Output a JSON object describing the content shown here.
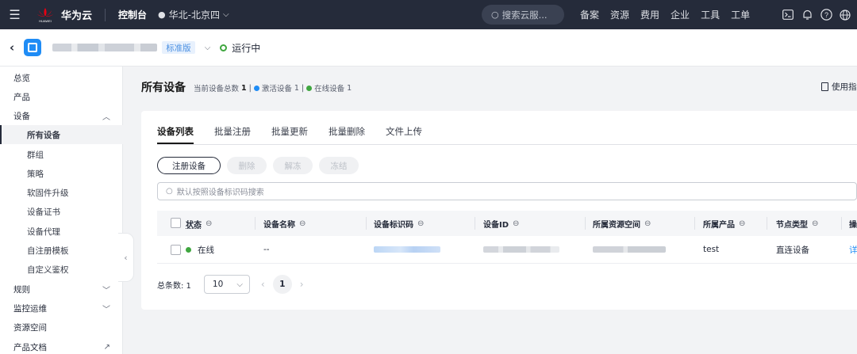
{
  "topbar": {
    "brand": "华为云",
    "brand_caption": "HUAWEI",
    "console": "控制台",
    "region": "华北-北京四",
    "search_placeholder": "搜索云服...",
    "nav": [
      "备案",
      "资源",
      "费用",
      "企业",
      "工具",
      "工单"
    ],
    "icons": [
      "terminal-icon",
      "bell-icon",
      "help-icon",
      "globe-icon"
    ]
  },
  "subbar": {
    "edition": "标准版",
    "status": "运行中",
    "status_color": "#3fa63f"
  },
  "sidebar": {
    "items": [
      {
        "label": "总览",
        "level": 1
      },
      {
        "label": "产品",
        "level": 1
      },
      {
        "label": "设备",
        "level": 1,
        "expanded": true
      },
      {
        "label": "所有设备",
        "level": 2,
        "active": true
      },
      {
        "label": "群组",
        "level": 2
      },
      {
        "label": "策略",
        "level": 2
      },
      {
        "label": "软固件升级",
        "level": 2
      },
      {
        "label": "设备证书",
        "level": 2
      },
      {
        "label": "设备代理",
        "level": 2
      },
      {
        "label": "自注册模板",
        "level": 2
      },
      {
        "label": "自定义鉴权",
        "level": 2
      },
      {
        "label": "规则",
        "level": 1,
        "expanded": false
      },
      {
        "label": "监控运维",
        "level": 1,
        "expanded": false
      },
      {
        "label": "资源空间",
        "level": 1
      },
      {
        "label": "产品文档",
        "level": 1,
        "external": true
      }
    ]
  },
  "page": {
    "title": "所有设备",
    "total_label": "当前设备总数",
    "total": "1",
    "active_label": "激活设备",
    "active": "1",
    "online_label": "在线设备",
    "online": "1",
    "guide": "使用指"
  },
  "tabs": [
    {
      "label": "设备列表",
      "active": true
    },
    {
      "label": "批量注册"
    },
    {
      "label": "批量更新"
    },
    {
      "label": "批量删除"
    },
    {
      "label": "文件上传"
    }
  ],
  "actions": {
    "register": "注册设备",
    "delete": "删除",
    "unfreeze": "解冻",
    "freeze": "冻结"
  },
  "filter_placeholder": "默认按照设备标识码搜索",
  "table": {
    "headers": [
      "状态",
      "设备名称",
      "设备标识码",
      "设备ID",
      "所属资源空间",
      "所属产品",
      "节点类型",
      "操"
    ],
    "rows": [
      {
        "status": "在线",
        "name": "--",
        "product": "test",
        "node_type": "直连设备",
        "action": "详"
      }
    ]
  },
  "pager": {
    "total_label": "总条数: 1",
    "page_size": "10",
    "current_page": "1"
  }
}
